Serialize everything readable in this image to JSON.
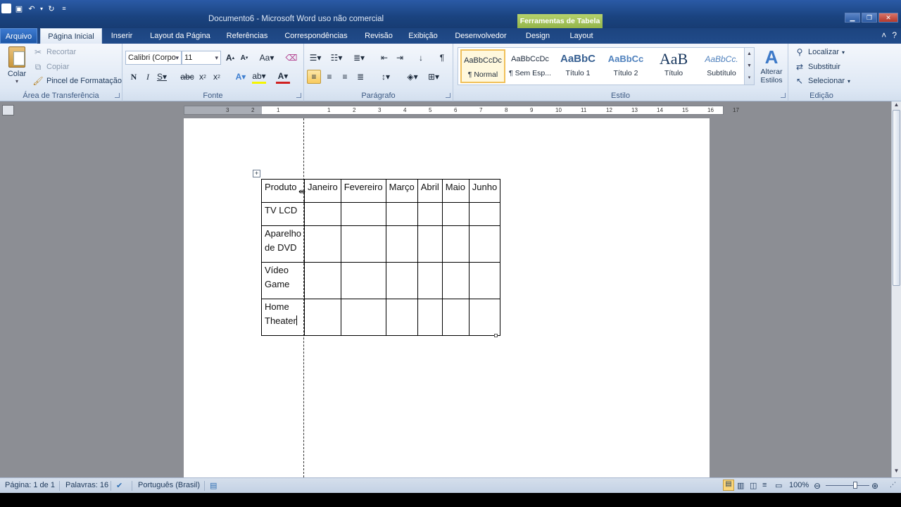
{
  "window": {
    "title": "Documento6 - Microsoft Word uso não comercial",
    "tools_title": "Ferramentas de Tabela"
  },
  "tabs": [
    {
      "label": "Arquivo"
    },
    {
      "label": "Página Inicial"
    },
    {
      "label": "Inserir"
    },
    {
      "label": "Layout da Página"
    },
    {
      "label": "Referências"
    },
    {
      "label": "Correspondências"
    },
    {
      "label": "Revisão"
    },
    {
      "label": "Exibição"
    },
    {
      "label": "Desenvolvedor"
    },
    {
      "label": "Design"
    },
    {
      "label": "Layout"
    }
  ],
  "clipboard": {
    "paste_label": "Colar",
    "cut_label": "Recortar",
    "copy_label": "Copiar",
    "format_painter_label": "Pincel de Formatação",
    "group_label": "Área de Transferência"
  },
  "font": {
    "family": "Calibri (Corpo",
    "size": "11",
    "group_label": "Fonte"
  },
  "paragraph": {
    "group_label": "Parágrafo"
  },
  "styles": {
    "group_label": "Estilo",
    "items": [
      {
        "preview": "AaBbCcDc",
        "name": "¶ Normal"
      },
      {
        "preview": "AaBbCcDc",
        "name": "¶ Sem Esp..."
      },
      {
        "preview": "AaBbC",
        "name": "Título 1"
      },
      {
        "preview": "AaBbCc",
        "name": "Título 2"
      },
      {
        "preview": "AaB",
        "name": "Título"
      },
      {
        "preview": "AaBbCc.",
        "name": "Subtítulo"
      }
    ],
    "change_label": "Alterar Estilos"
  },
  "editing": {
    "find_label": "Localizar",
    "replace_label": "Substituir",
    "select_label": "Selecionar",
    "group_label": "Edição"
  },
  "ruler": {
    "numbers": [
      "3",
      "2",
      "1",
      "1",
      "2",
      "3",
      "4",
      "5",
      "6",
      "7",
      "8",
      "9",
      "10",
      "11",
      "12",
      "13",
      "14",
      "15",
      "16",
      "17"
    ]
  },
  "table": {
    "headers": [
      "Produto",
      "Janeiro",
      "Fevereiro",
      "Março",
      "Abril",
      "Maio",
      "Junho"
    ],
    "rows": [
      {
        "lines": [
          "TV LCD"
        ]
      },
      {
        "lines": [
          "Aparelho",
          "de DVD"
        ]
      },
      {
        "lines": [
          "Vídeo",
          "Game"
        ]
      },
      {
        "lines": [
          "Home",
          "Theater"
        ]
      }
    ]
  },
  "status": {
    "page": "Página: 1 de 1",
    "words": "Palavras: 16",
    "language": "Português (Brasil)",
    "zoom": "100%"
  }
}
